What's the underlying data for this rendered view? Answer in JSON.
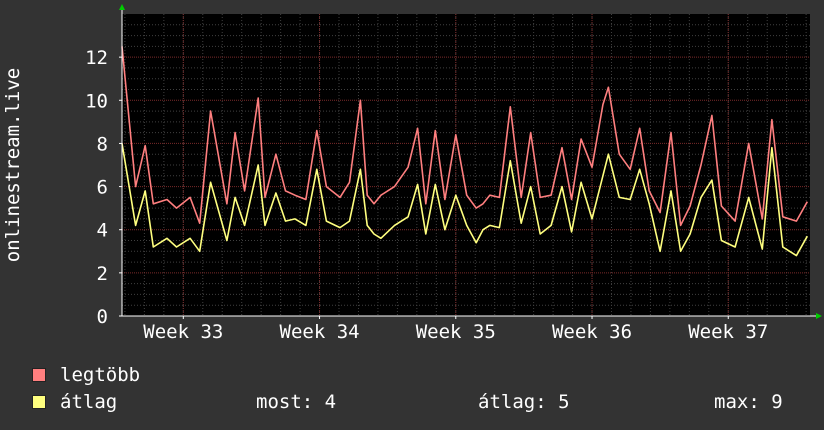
{
  "chart_data": {
    "type": "line",
    "ylabel": "onlinestream.live",
    "ylim": [
      0,
      14
    ],
    "yticks": [
      0,
      2,
      4,
      6,
      8,
      10,
      12
    ],
    "x_range_weeks": [
      32.55,
      37.6
    ],
    "xticks": [
      {
        "value": 33,
        "label": "Week 33"
      },
      {
        "value": 34,
        "label": "Week 34"
      },
      {
        "value": 35,
        "label": "Week 35"
      },
      {
        "value": 36,
        "label": "Week 36"
      },
      {
        "value": 37,
        "label": "Week 37"
      }
    ],
    "grid": true,
    "colors": {
      "background": "#333333",
      "plot_area": "#000000",
      "grid": "#404040",
      "series_max": "#ff7f7f",
      "series_avg": "#ffff7f"
    },
    "series": [
      {
        "name": "legtöbb",
        "color": "#ff7f7f",
        "x_weeks": [
          32.55,
          32.65,
          32.72,
          32.78,
          32.88,
          32.95,
          33.05,
          33.12,
          33.2,
          33.32,
          33.38,
          33.45,
          33.55,
          33.6,
          33.68,
          33.75,
          33.82,
          33.9,
          33.98,
          34.05,
          34.15,
          34.22,
          34.3,
          34.35,
          34.4,
          34.45,
          34.55,
          34.65,
          34.72,
          34.78,
          34.85,
          34.92,
          35.0,
          35.08,
          35.15,
          35.2,
          35.25,
          35.32,
          35.4,
          35.48,
          35.55,
          35.62,
          35.7,
          35.78,
          35.85,
          35.92,
          36.0,
          36.08,
          36.12,
          36.2,
          36.28,
          36.35,
          36.42,
          36.5,
          36.58,
          36.65,
          36.72,
          36.8,
          36.88,
          36.95,
          37.05,
          37.15,
          37.25,
          37.32,
          37.4,
          37.5,
          37.58
        ],
        "values": [
          12.5,
          6.0,
          7.9,
          5.2,
          5.4,
          5.0,
          5.5,
          4.3,
          9.5,
          5.2,
          8.5,
          5.8,
          10.1,
          5.5,
          7.5,
          5.8,
          5.6,
          5.4,
          8.6,
          6.0,
          5.5,
          6.2,
          10.0,
          5.6,
          5.2,
          5.6,
          6.0,
          6.9,
          8.7,
          5.2,
          8.6,
          5.4,
          8.4,
          5.6,
          5.0,
          5.2,
          5.6,
          5.5,
          9.7,
          5.5,
          8.5,
          5.5,
          5.6,
          7.8,
          5.4,
          8.2,
          6.9,
          9.8,
          10.6,
          7.5,
          6.8,
          8.7,
          5.8,
          4.8,
          8.5,
          4.2,
          5.1,
          7.0,
          9.3,
          5.1,
          4.4,
          8.0,
          4.5,
          9.1,
          4.6,
          4.4,
          5.3
        ]
      },
      {
        "name": "átlag",
        "color": "#ffff7f",
        "x_weeks": [
          32.55,
          32.65,
          32.72,
          32.78,
          32.88,
          32.95,
          33.05,
          33.12,
          33.2,
          33.32,
          33.38,
          33.45,
          33.55,
          33.6,
          33.68,
          33.75,
          33.82,
          33.9,
          33.98,
          34.05,
          34.15,
          34.22,
          34.3,
          34.35,
          34.4,
          34.45,
          34.55,
          34.65,
          34.72,
          34.78,
          34.85,
          34.92,
          35.0,
          35.08,
          35.15,
          35.2,
          35.25,
          35.32,
          35.4,
          35.48,
          35.55,
          35.62,
          35.7,
          35.78,
          35.85,
          35.92,
          36.0,
          36.08,
          36.12,
          36.2,
          36.28,
          36.35,
          36.42,
          36.5,
          36.58,
          36.65,
          36.72,
          36.8,
          36.88,
          36.95,
          37.05,
          37.15,
          37.25,
          37.32,
          37.4,
          37.5,
          37.58
        ],
        "values": [
          8.0,
          4.2,
          5.8,
          3.2,
          3.6,
          3.2,
          3.6,
          3.0,
          6.2,
          3.5,
          5.5,
          4.2,
          7.0,
          4.2,
          5.7,
          4.4,
          4.5,
          4.2,
          6.8,
          4.4,
          4.1,
          4.4,
          6.8,
          4.2,
          3.8,
          3.6,
          4.2,
          4.6,
          6.1,
          3.8,
          6.1,
          4.0,
          5.6,
          4.2,
          3.4,
          4.0,
          4.2,
          4.1,
          7.2,
          4.3,
          6.0,
          3.8,
          4.2,
          6.0,
          3.9,
          6.2,
          4.5,
          6.5,
          7.5,
          5.5,
          5.4,
          6.8,
          5.2,
          3.0,
          5.8,
          3.0,
          3.8,
          5.5,
          6.3,
          3.5,
          3.2,
          5.5,
          3.1,
          7.8,
          3.2,
          2.8,
          3.7
        ]
      }
    ]
  },
  "legend": {
    "max_label": "legtöbb",
    "avg_label": "átlag"
  },
  "stats": {
    "current": "most: 4",
    "average": "átlag: 5",
    "maximum": "max: 9"
  }
}
